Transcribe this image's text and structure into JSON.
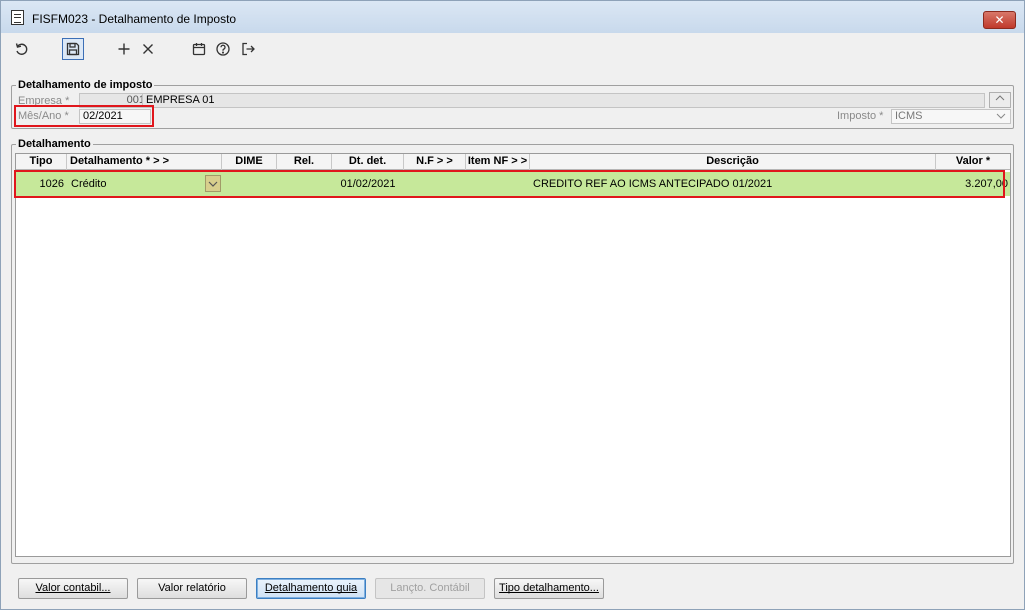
{
  "window": {
    "title": "FISFM023 - Detalhamento de Imposto",
    "close_label": "✕"
  },
  "toolbar": {
    "items": [
      "undo-icon",
      "save-icon",
      "add-icon",
      "delete-icon",
      "calendar-icon",
      "help-icon",
      "exit-icon"
    ]
  },
  "header_group": {
    "label": "Detalhamento de imposto",
    "empresa_label": "Empresa *",
    "empresa_code": "001",
    "empresa_name": "EMPRESA 01",
    "mesano_label": "Mês/Ano *",
    "mesano_value": "02/2021",
    "imposto_label": "Imposto *",
    "imposto_value": "ICMS"
  },
  "detail_group": {
    "label": "Detalhamento",
    "columns": [
      "Tipo",
      "Detalhamento *  > >",
      "DIME",
      "Rel.",
      "Dt. det.",
      "N.F  > >",
      "Item NF > >",
      "Descrição",
      "Valor *"
    ],
    "rows": [
      {
        "tipo": "1026",
        "detalhamento": "Crédito",
        "dime": "",
        "rel": "",
        "dt_det": "01/02/2021",
        "nf": "",
        "item_nf": "",
        "descricao": "CREDITO REF AO ICMS ANTECIPADO 01/2021",
        "valor": "3.207,00"
      }
    ]
  },
  "buttons": {
    "valor_contabil": "Valor contabil...",
    "valor_relatorio": "Valor relatório",
    "detalhamento_guia": "Detalhamento guia",
    "lancto_contabil": "Lançto. Contábil",
    "tipo_detalhamento": "Tipo detalhamento..."
  },
  "colors": {
    "selected_row": "#c6e89a",
    "highlight_box": "#e0161c"
  }
}
